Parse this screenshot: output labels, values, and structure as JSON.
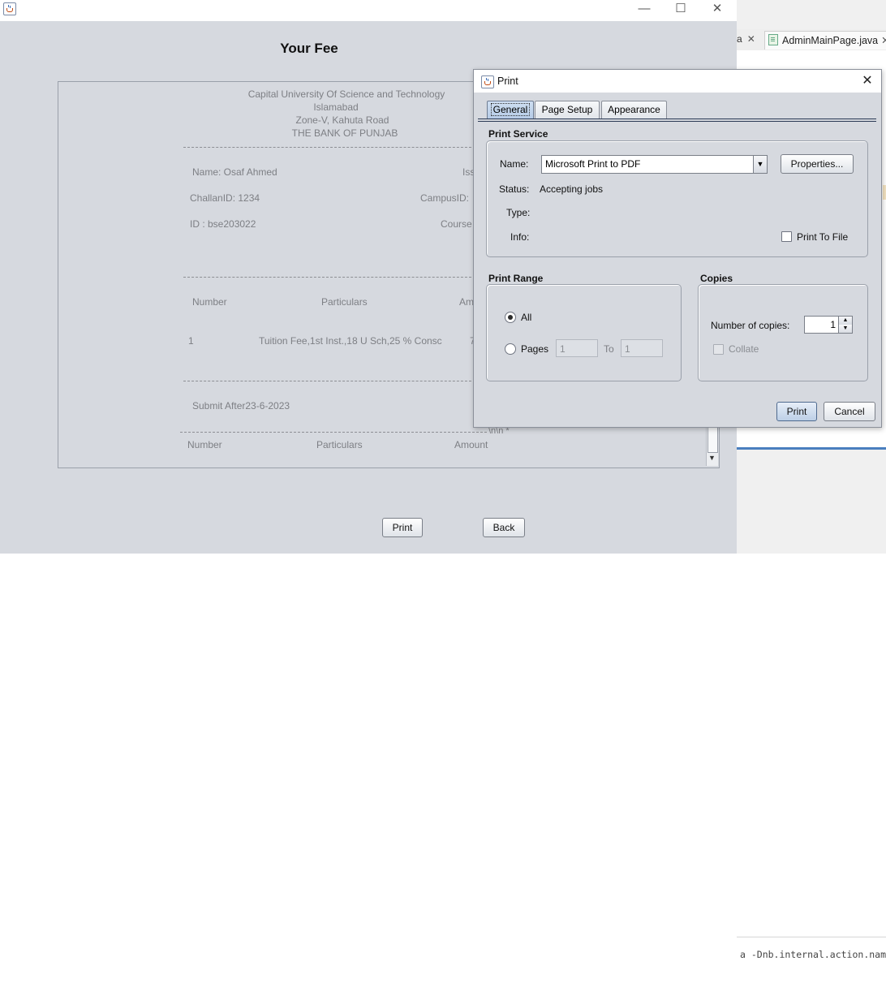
{
  "ide": {
    "tab_partial": "a",
    "tab_file": "AdminMainPage.java",
    "close_glyph": "✕",
    "output_command": "a -Dnb.internal.action.nam"
  },
  "window": {
    "minimize": "—",
    "maximize": "☐",
    "close": "✕"
  },
  "page": {
    "title": "Your Fee"
  },
  "challan": {
    "university": "Capital University Of Science and Technology",
    "city": "Islamabad",
    "address": "Zone-V, Kahuta Road",
    "bank": "THE BANK OF PUNJAB",
    "name_line": "Name: Osaf Ahmed",
    "issue_partial": "Iss",
    "challan_id": "ChallanID: 1234",
    "campus_partial": "CampusID:",
    "student_id": "ID : bse203022",
    "course_partial": "Course",
    "headers": {
      "number": "Number",
      "particulars": "Particulars",
      "amount_partial": "Am"
    },
    "row": {
      "number": "1",
      "particulars": "Tuition Fee,1st Inst.,18 U Sch,25 % Consc",
      "amount_partial": "7"
    },
    "submit_after": "Submit After23-6-2023",
    "separator_tail": "\\n\\n  *",
    "headers2": {
      "number": "Number",
      "particulars": "Particulars",
      "amount": "Amount"
    }
  },
  "buttons": {
    "print": "Print",
    "back": "Back"
  },
  "dialog": {
    "title": "Print",
    "close": "✕",
    "tabs": [
      "General",
      "Page Setup",
      "Appearance"
    ],
    "print_service": {
      "section": "Print Service",
      "name_label": "Name:",
      "name_value": "Microsoft Print to PDF",
      "properties_button": "Properties...",
      "status_label": "Status:",
      "status_value": "Accepting jobs",
      "type_label": "Type:",
      "info_label": "Info:",
      "print_to_file": "Print To File"
    },
    "print_range": {
      "section": "Print Range",
      "all_label": "All",
      "pages_label": "Pages",
      "from_value": "1",
      "to_label": "To",
      "to_value": "1",
      "selected": "All"
    },
    "copies": {
      "section": "Copies",
      "number_label": "Number of copies:",
      "number_value": "1",
      "collate_label": "Collate"
    },
    "print_button": "Print",
    "cancel_button": "Cancel"
  }
}
